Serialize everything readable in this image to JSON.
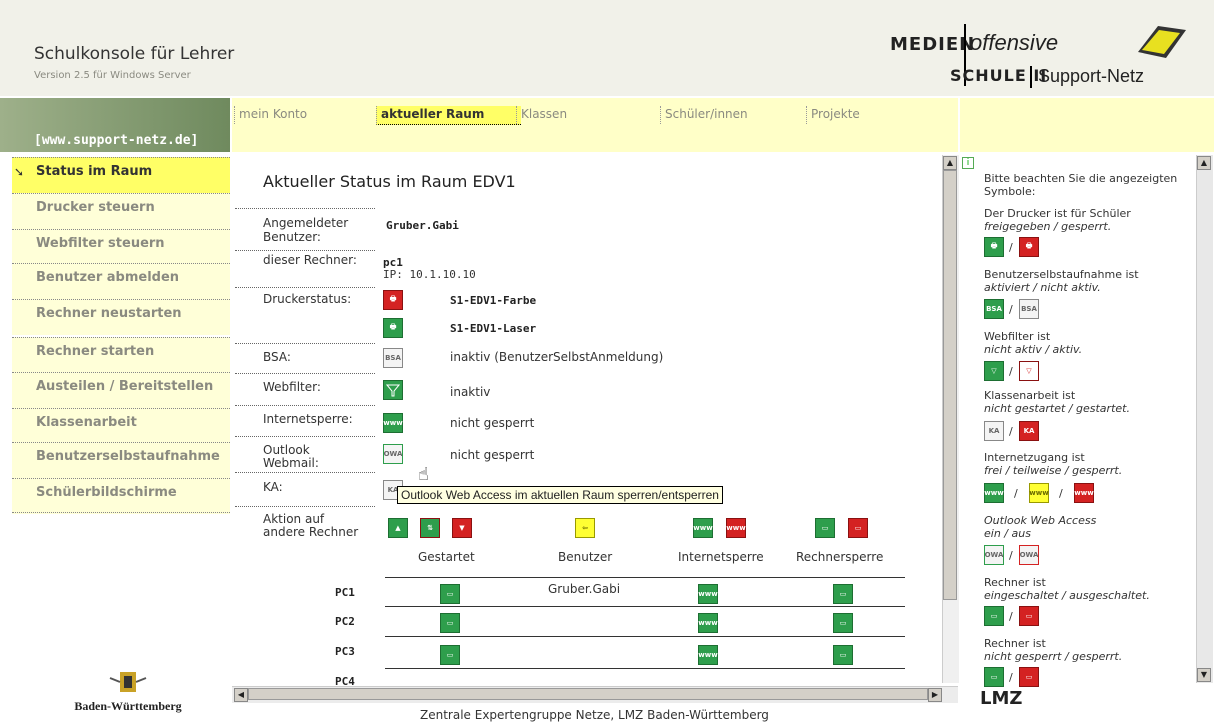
{
  "header": {
    "title": "Schulkonsole für Lehrer",
    "version": "Version 2.5 für Windows Server",
    "logo": {
      "medien": "MEDIEN",
      "offensive": "offensive",
      "schule": "SCHULE II",
      "support": "Support-Netz"
    }
  },
  "banner": {
    "text": "[www.support-netz.de]"
  },
  "tabs": [
    {
      "label": "mein Konto"
    },
    {
      "label": "aktueller Raum"
    },
    {
      "label": "Klassen"
    },
    {
      "label": "Schüler/innen"
    },
    {
      "label": "Projekte"
    }
  ],
  "sidebar": {
    "items": [
      {
        "label": "Status im Raum"
      },
      {
        "label": "Drucker steuern"
      },
      {
        "label": "Webfilter steuern"
      },
      {
        "label": "Benutzer abmelden"
      },
      {
        "label": "Rechner neustarten"
      },
      {
        "label": "Rechner starten"
      },
      {
        "label": "Austeilen / Bereitstellen"
      },
      {
        "label": "Klassenarbeit"
      },
      {
        "label": "Benutzerselbstaufnahme"
      },
      {
        "label": "Schülerbildschirme"
      }
    ],
    "logo": "Baden-Württemberg"
  },
  "main": {
    "title": "Aktueller Status im Raum EDV1",
    "rows": {
      "user_label": "Angemeldeter Benutzer:",
      "user_value": "Gruber.Gabi",
      "pc_label": "dieser Rechner:",
      "pc_value": "pc1",
      "ip": "IP: 10.1.10.10",
      "printer_label": "Druckerstatus:",
      "printer1": "S1-EDV1-Farbe",
      "printer2": "S1-EDV1-Laser",
      "bsa_label": "BSA:",
      "bsa_value": "inaktiv (BenutzerSelbstAnmeldung)",
      "web_label": "Webfilter:",
      "web_value": "inaktiv",
      "inet_label": "Internetsperre:",
      "inet_value": "nicht gesperrt",
      "owa_label1": "Outlook",
      "owa_label2": "Webmail:",
      "owa_value": "nicht gesperrt",
      "ka_label": "KA:",
      "action_label1": "Aktion auf",
      "action_label2": "andere Rechner"
    },
    "columns": [
      "Gestartet",
      "Benutzer",
      "Internetsperre",
      "Rechnersperre"
    ],
    "pcs": [
      {
        "name": "PC1",
        "user": "Gruber.Gabi"
      },
      {
        "name": "PC2",
        "user": ""
      },
      {
        "name": "PC3",
        "user": ""
      },
      {
        "name": "PC4",
        "user": ""
      }
    ],
    "tooltip": "Outlook Web Access im aktuellen Raum sperren/entsperren",
    "footer": "Zentrale Expertengruppe Netze, LMZ Baden-Württemberg"
  },
  "right": {
    "intro": "Bitte beachten Sie die angezeigten Symbole:",
    "printer": "Der Drucker ist für Schüler",
    "printer_i": "freigegeben / gesperrt.",
    "bsa": "Benutzerselbstaufnahme ist",
    "bsa_i": "aktiviert / nicht aktiv.",
    "web": "Webfilter ist",
    "web_i": "nicht aktiv / aktiv.",
    "ka": "Klassenarbeit ist",
    "ka_i": "nicht gestartet / gestartet.",
    "inet": "Internetzugang ist",
    "inet_i": "frei / teilweise / gesperrt.",
    "owa_i": "Outlook Web Access",
    "owa_i2": "ein / aus",
    "pc": "Rechner ist",
    "pc_i": "eingeschaltet / ausgeschaltet.",
    "lock": "Rechner ist",
    "lock_i": "nicht gesperrt / gesperrt.",
    "logo": "LMZ"
  },
  "icons": {
    "bsa": "BSA",
    "ka": "KA",
    "owa": "OWA",
    "www": "www"
  }
}
